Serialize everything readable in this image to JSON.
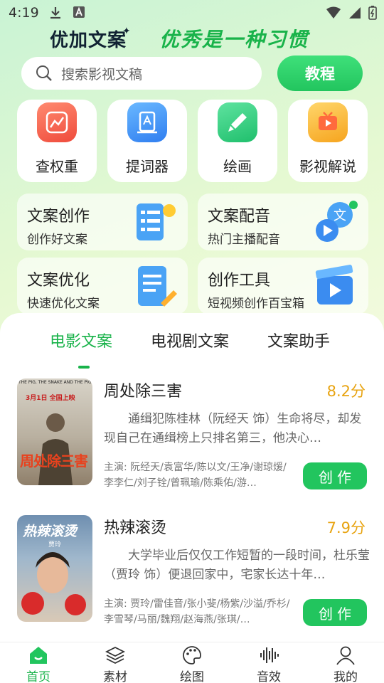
{
  "status_bar": {
    "time": "4:19"
  },
  "header": {
    "brand": "优加文案",
    "brand_star": "✦",
    "slogan": "优秀是一种习惯"
  },
  "search": {
    "placeholder": "搜索影视文稿",
    "tutorial_button": "教程"
  },
  "quick_tiles": [
    {
      "label": "查权重",
      "icon": "chart-icon",
      "color": "#f0584a"
    },
    {
      "label": "提词器",
      "icon": "prompter-icon",
      "color": "#3b8cf0"
    },
    {
      "label": "绘画",
      "icon": "brush-icon",
      "color": "#2cc97a"
    },
    {
      "label": "影视解说",
      "icon": "tv-icon",
      "color": "#f6b82e"
    }
  ],
  "feature_cards": [
    {
      "title": "文案创作",
      "subtitle": "创作好文案"
    },
    {
      "title": "文案配音",
      "subtitle": "热门主播配音",
      "art_text": "文"
    },
    {
      "title": "文案优化",
      "subtitle": "快速优化文案"
    },
    {
      "title": "创作工具",
      "subtitle": "短视频创作百宝箱"
    }
  ],
  "tabs": [
    {
      "label": "电影文案",
      "active": true
    },
    {
      "label": "电视剧文案",
      "active": false
    },
    {
      "label": "文案助手",
      "active": false
    }
  ],
  "movies": [
    {
      "title": "周处除三害",
      "score": "8.2分",
      "description": "通缉犯陈桂林（阮经天 饰）生命将尽，却发现自己在通缉榜上只排名第三，他决心…",
      "cast": "主演: 阮经天/袁富华/陈以文/王净/谢琼煖/李李仁/刘子铨/曾珮瑜/陈乘佑/游…",
      "action": "创作",
      "poster_title": "周处除三害",
      "poster_top": "THE PIG, THE SNAKE AND THE PIGEON",
      "poster_release": "3月1日 全国上映"
    },
    {
      "title": "热辣滚烫",
      "score": "7.9分",
      "description": "大学毕业后仅仅工作短暂的一段时间，杜乐莹（贾玲 饰）便退回家中，宅家长达十年…",
      "cast": "主演: 贾玲/雷佳音/张小斐/杨紫/沙溢/乔杉/李雪琴/马丽/魏翔/赵海燕/张琪/…",
      "action": "创作",
      "poster_title": "热辣滚烫",
      "poster_director": "贾玲"
    }
  ],
  "bottom_nav": [
    {
      "label": "首页",
      "icon": "home-icon",
      "active": true
    },
    {
      "label": "素材",
      "icon": "layers-icon",
      "active": false
    },
    {
      "label": "绘图",
      "icon": "palette-icon",
      "active": false
    },
    {
      "label": "音效",
      "icon": "waveform-icon",
      "active": false
    },
    {
      "label": "我的",
      "icon": "user-icon",
      "active": false
    }
  ],
  "colors": {
    "accent": "#22c55e",
    "score": "#e8a412"
  }
}
